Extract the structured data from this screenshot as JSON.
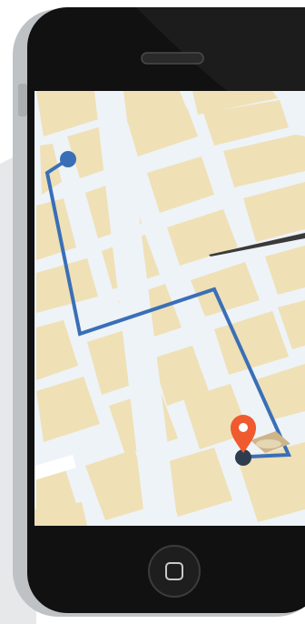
{
  "illustration": {
    "subject": "smartphone-showing-map-navigation",
    "colors": {
      "backdrop": "#e7e8e9",
      "phone_shell": "#bfc2c4",
      "phone_face": "#111111",
      "map_block": "#efe0b6",
      "map_road": "#eef3f7",
      "route": "#3a6fb7",
      "start_dot": "#3a6fb7",
      "pin": "#ef5a2e",
      "current_location_dot": "#2d3d4e"
    },
    "icons": {
      "speaker": "speaker-slot-icon",
      "home_button": "home-button-icon",
      "start": "route-start-dot-icon",
      "destination": "map-pin-icon",
      "current": "location-dot-icon"
    }
  }
}
